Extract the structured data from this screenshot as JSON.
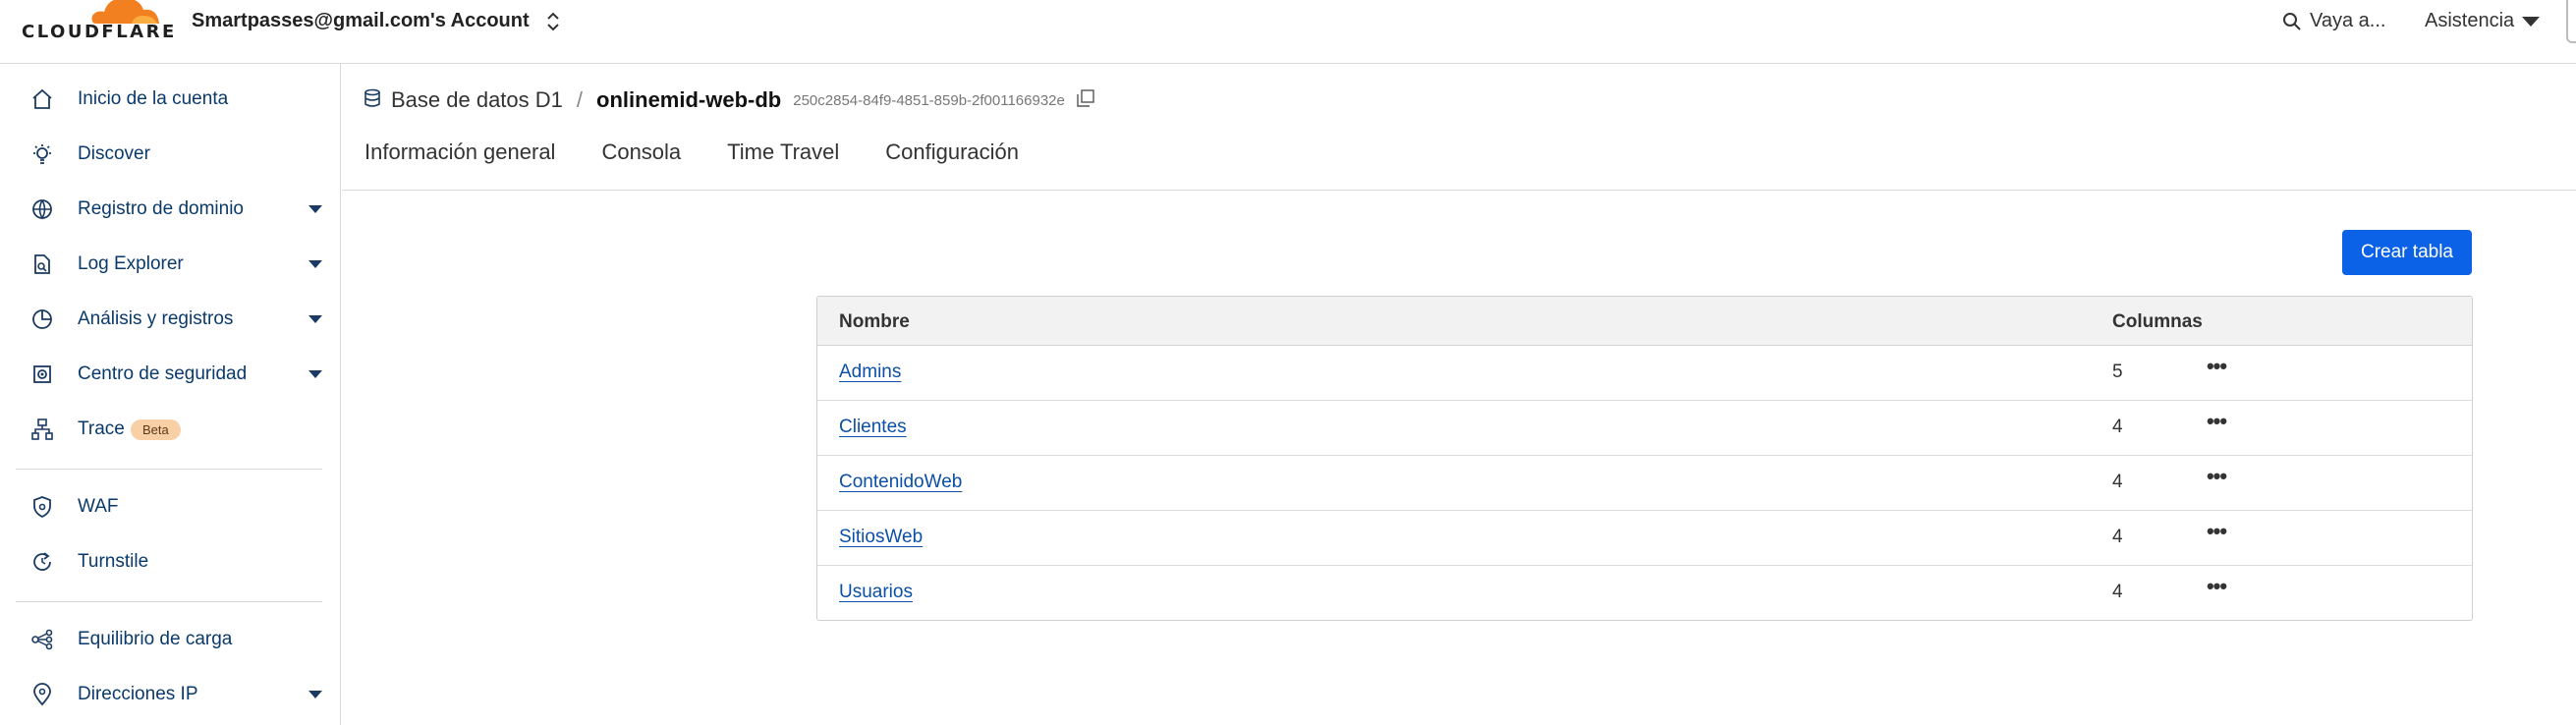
{
  "brand": {
    "logo_text": "CLOUDFLARE",
    "accent": "#f38020"
  },
  "header": {
    "account": "Smartpasses@gmail.com's Account",
    "search_label": "Vaya a...",
    "help_label": "Asistencia"
  },
  "sidebar": {
    "items": [
      {
        "label": "Inicio de la cuenta",
        "icon": "home-icon",
        "expand": false
      },
      {
        "label": "Discover",
        "icon": "lightbulb-icon",
        "expand": false
      },
      {
        "label": "Registro de dominio",
        "icon": "globe-icon",
        "expand": true
      },
      {
        "label": "Log Explorer",
        "icon": "document-search-icon",
        "expand": true
      },
      {
        "label": "Análisis y registros",
        "icon": "pie-chart-icon",
        "expand": true
      },
      {
        "label": "Centro de seguridad",
        "icon": "security-center-icon",
        "expand": true
      },
      {
        "label": "Trace",
        "icon": "network-icon",
        "expand": false,
        "badge": "Beta"
      },
      {
        "label": "WAF",
        "icon": "shield-icon",
        "expand": false
      },
      {
        "label": "Turnstile",
        "icon": "refresh-icon",
        "expand": false
      },
      {
        "label": "Equilibrio de carga",
        "icon": "load-balancer-icon",
        "expand": false
      },
      {
        "label": "Direcciones IP",
        "icon": "location-pin-icon",
        "expand": true
      }
    ]
  },
  "breadcrumb": {
    "section": "Base de datos D1",
    "separator": "/",
    "current": "onlinemid-web-db",
    "id": "250c2854-84f9-4851-859b-2f001166932e"
  },
  "tabs": [
    "Información general",
    "Consola",
    "Time Travel",
    "Configuración"
  ],
  "actions": {
    "create_table": "Crear tabla"
  },
  "table": {
    "columns": [
      "Nombre",
      "Columnas"
    ],
    "rows": [
      {
        "name": "Admins",
        "columns": "5"
      },
      {
        "name": "Clientes",
        "columns": "4"
      },
      {
        "name": "ContenidoWeb",
        "columns": "4"
      },
      {
        "name": "SitiosWeb",
        "columns": "4"
      },
      {
        "name": "Usuarios",
        "columns": "4"
      }
    ],
    "row_action": "•••"
  },
  "colors": {
    "link": "#0b4fa8",
    "primary_button": "#0b62e6",
    "badge": "#f9cfa6"
  }
}
